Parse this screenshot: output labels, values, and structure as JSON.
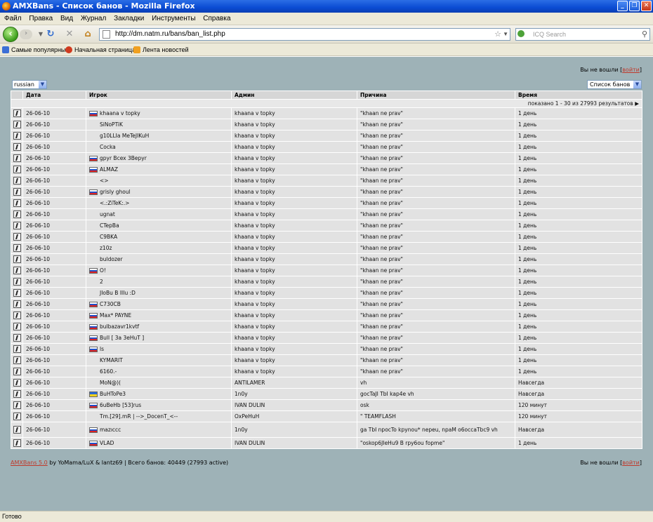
{
  "window": {
    "title": "AMXBans - Список банов - Mozilla Firefox"
  },
  "menu": [
    "Файл",
    "Правка",
    "Вид",
    "Журнал",
    "Закладки",
    "Инструменты",
    "Справка"
  ],
  "address": {
    "url": "http://dm.natm.ru/bans/ban_list.php"
  },
  "search": {
    "placeholder": "ICQ Search"
  },
  "bookmarks": [
    "Самые популярные",
    "Начальная страница",
    "Лента новостей"
  ],
  "page": {
    "login_text": "Вы не вошли [",
    "login_link": "войти",
    "login_close": "]",
    "language": "russian",
    "view_select": "Список банов",
    "columns": [
      "Дата",
      "Игрок",
      "Админ",
      "Причина",
      "Время"
    ],
    "results_info": "показано 1 - 30 из 27993 результатов",
    "rows": [
      {
        "date": "26-06-10",
        "flag": "ru",
        "player": "khaana v topky",
        "admin": "khaana v topky",
        "reason": "\"khaan ne prav\"",
        "time": "1 день"
      },
      {
        "date": "26-06-10",
        "flag": "none",
        "player": "SiNoPTiK",
        "admin": "khaana v topky",
        "reason": "\"khaan ne prav\"",
        "time": "1 день"
      },
      {
        "date": "26-06-10",
        "flag": "none",
        "player": "g10LLIa MeTeJIKuH",
        "admin": "khaana v topky",
        "reason": "\"khaan ne prav\"",
        "time": "1 день"
      },
      {
        "date": "26-06-10",
        "flag": "none",
        "player": "Cocka",
        "admin": "khaana v topky",
        "reason": "\"khaan ne prav\"",
        "time": "1 день"
      },
      {
        "date": "26-06-10",
        "flag": "ru",
        "player": "gpyr Bcex 3Bepyr",
        "admin": "khaana v topky",
        "reason": "\"khaan ne prav\"",
        "time": "1 день"
      },
      {
        "date": "26-06-10",
        "flag": "ru",
        "player": "ALMAZ",
        "admin": "khaana v topky",
        "reason": "\"khaan ne prav\"",
        "time": "1 день"
      },
      {
        "date": "26-06-10",
        "flag": "none",
        "player": "<>",
        "admin": "khaana v topky",
        "reason": "\"khaan ne prav\"",
        "time": "1 день"
      },
      {
        "date": "26-06-10",
        "flag": "ru",
        "player": "grisly ghoul",
        "admin": "khaana v topky",
        "reason": "\"khaan ne prav\"",
        "time": "1 день"
      },
      {
        "date": "26-06-10",
        "flag": "none",
        "player": "<.:ZiTeK:.>",
        "admin": "khaana v topky",
        "reason": "\"khaan ne prav\"",
        "time": "1 день"
      },
      {
        "date": "26-06-10",
        "flag": "none",
        "player": "ugnat",
        "admin": "khaana v topky",
        "reason": "\"khaan ne prav\"",
        "time": "1 день"
      },
      {
        "date": "26-06-10",
        "flag": "none",
        "player": "CTepBa",
        "admin": "khaana v topky",
        "reason": "\"khaan ne prav\"",
        "time": "1 день"
      },
      {
        "date": "26-06-10",
        "flag": "none",
        "player": "C9BKA",
        "admin": "khaana v topky",
        "reason": "\"khaan ne prav\"",
        "time": "1 день"
      },
      {
        "date": "26-06-10",
        "flag": "none",
        "player": "z10z",
        "admin": "khaana v topky",
        "reason": "\"khaan ne prav\"",
        "time": "1 день"
      },
      {
        "date": "26-06-10",
        "flag": "none",
        "player": "buldozer",
        "admin": "khaana v topky",
        "reason": "\"khaan ne prav\"",
        "time": "1 день"
      },
      {
        "date": "26-06-10",
        "flag": "ru",
        "player": "O!",
        "admin": "khaana v topky",
        "reason": "\"khaan ne prav\"",
        "time": "1 день"
      },
      {
        "date": "26-06-10",
        "flag": "none",
        "player": "2",
        "admin": "khaana v topky",
        "reason": "\"khaan ne prav\"",
        "time": "1 день"
      },
      {
        "date": "26-06-10",
        "flag": "none",
        "player": "JIoBu B IIIu :D",
        "admin": "khaana v topky",
        "reason": "\"khaan ne prav\"",
        "time": "1 день"
      },
      {
        "date": "26-06-10",
        "flag": "ru",
        "player": "C730CB",
        "admin": "khaana v topky",
        "reason": "\"khaan ne prav\"",
        "time": "1 день"
      },
      {
        "date": "26-06-10",
        "flag": "ru",
        "player": "Max* PAYNE",
        "admin": "khaana v topky",
        "reason": "\"khaan ne prav\"",
        "time": "1 день"
      },
      {
        "date": "26-06-10",
        "flag": "ru",
        "player": "bulbazavr1kvtf",
        "admin": "khaana v topky",
        "reason": "\"khaan ne prav\"",
        "time": "1 день"
      },
      {
        "date": "26-06-10",
        "flag": "ru",
        "player": "Bull [ 3a 3eHuT ]",
        "admin": "khaana v topky",
        "reason": "\"khaan ne prav\"",
        "time": "1 день"
      },
      {
        "date": "26-06-10",
        "flag": "ru",
        "player": "ls",
        "admin": "khaana v topky",
        "reason": "\"khaan ne prav\"",
        "time": "1 день"
      },
      {
        "date": "26-06-10",
        "flag": "none",
        "player": "KYMARIT",
        "admin": "khaana v topky",
        "reason": "\"khaan ne prav\"",
        "time": "1 день"
      },
      {
        "date": "26-06-10",
        "flag": "none",
        "player": "6160.-",
        "admin": "khaana v topky",
        "reason": "\"khaan ne prav\"",
        "time": "1 день"
      },
      {
        "date": "26-06-10",
        "flag": "none",
        "player": "MoN@)(",
        "admin": "ANTILAMER",
        "reason": "vh",
        "time": "Навсегда"
      },
      {
        "date": "26-06-10",
        "flag": "ua",
        "player": "BuHToPe3",
        "admin": "1n0y",
        "reason": "gocTaJI TbI kap4e vh",
        "time": "Навсегда"
      },
      {
        "date": "26-06-10",
        "flag": "ru",
        "player": "6uBeHb [53]rus",
        "admin": "IVAN DULIN",
        "reason": "osk",
        "time": "120 минут"
      },
      {
        "date": "26-06-10",
        "flag": "none",
        "player": "Tm.[29].mR | -->_DocenT_<--",
        "admin": "OxPeHuH",
        "reason": "\" TEAMFLASH",
        "time": "120 минут"
      },
      {
        "date": "26-06-10",
        "flag": "ru",
        "player": "mazıccc",
        "admin": "1n0y",
        "reason": "ga TbI npocTo kpynou* nepeu, npaM o6occaTbc9 vh",
        "time": "Навсегда"
      },
      {
        "date": "26-06-10",
        "flag": "ru",
        "player": "VLAD",
        "admin": "IVAN DULIN",
        "reason": "\"oskop6JIeHu9 B rpy6ou fopme\"",
        "time": "1 день"
      }
    ],
    "footer_link": "AMXBans 5.0",
    "footer_text": " by YoMama/LuX & lantz69 | Всего банов: 40449 (27993 active)"
  },
  "status": "Готово"
}
